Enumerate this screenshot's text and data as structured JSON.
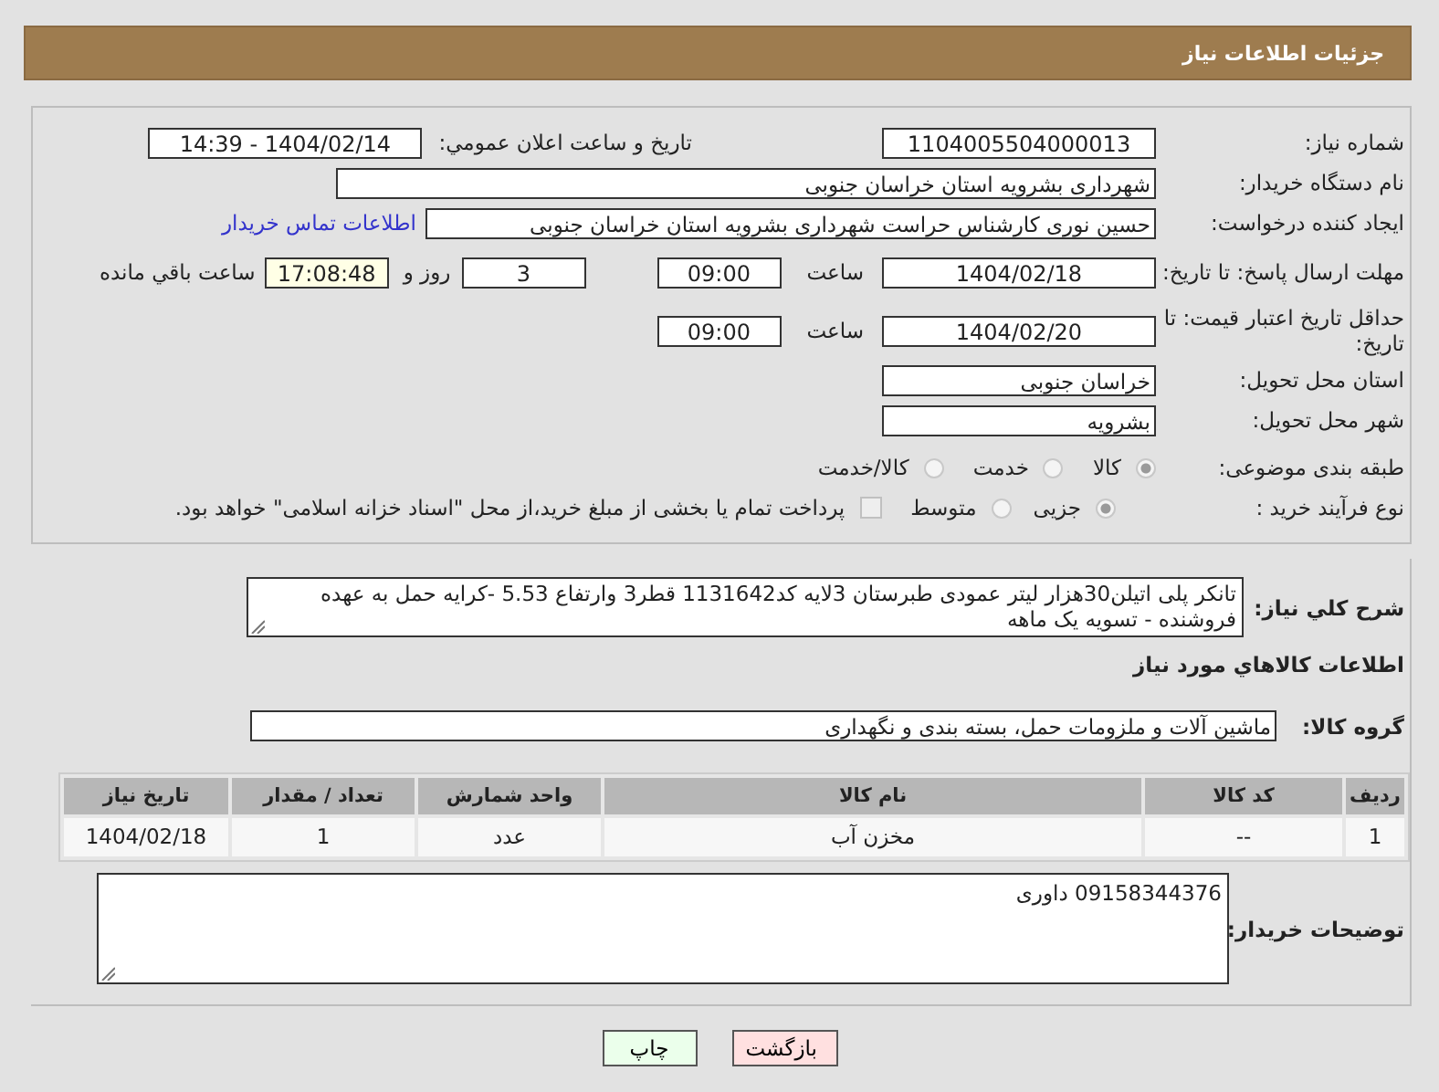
{
  "header": {
    "title": "جزئیات اطلاعات نیاز"
  },
  "need_number": {
    "label": "شماره نیاز:",
    "value": "1104005504000013"
  },
  "announce": {
    "label": "تاریخ و ساعت اعلان عمومي:",
    "value": "1404/02/14 - 14:39"
  },
  "buyer_org": {
    "label": "نام دستگاه خریدار:",
    "value": "شهرداری بشرویه استان خراسان جنوبی"
  },
  "requester": {
    "label": "ایجاد کننده درخواست:",
    "value": "حسین نوری کارشناس حراست شهرداری بشرویه استان خراسان جنوبی",
    "link": "اطلاعات تماس خریدار"
  },
  "response_deadline": {
    "label": "مهلت ارسال پاسخ: تا تاریخ:",
    "date": "1404/02/18",
    "time_label": "ساعت",
    "time": "09:00",
    "days": "3",
    "days_label": "روز و",
    "remaining": "17:08:48",
    "remaining_label": "ساعت باقي مانده"
  },
  "price_validity": {
    "label": "حداقل تاریخ اعتبار قیمت: تا تاریخ:",
    "date": "1404/02/20",
    "time_label": "ساعت",
    "time": "09:00"
  },
  "delivery_province": {
    "label": "استان محل تحویل:",
    "value": "خراسان جنوبی"
  },
  "delivery_city": {
    "label": "شهر محل تحویل:",
    "value": "بشرویه"
  },
  "subject_category": {
    "label": "طبقه بندی موضوعی:",
    "options": [
      {
        "label": "کالا",
        "selected": true
      },
      {
        "label": "خدمت",
        "selected": false
      },
      {
        "label": "کالا/خدمت",
        "selected": false
      }
    ]
  },
  "purchase_type": {
    "label": "نوع فرآیند خرید :",
    "options": [
      {
        "label": "جزیی",
        "selected": true
      },
      {
        "label": "متوسط",
        "selected": false
      }
    ],
    "treasury": {
      "label": "پرداخت تمام یا بخشی از مبلغ خرید،از محل \"اسناد خزانه اسلامی\" خواهد بود.",
      "checked": false
    }
  },
  "description": {
    "label": "شرح کلي نیاز:",
    "value": "تانکر پلی اتیلن30هزار لیتر عمودی طبرستان 3لایه کد1131642 قطر3 وارتفاع 5.53 -کرایه حمل به عهده فروشنده - تسویه یک ماهه"
  },
  "goods_section_title": "اطلاعات کالاهاي مورد نیاز",
  "goods_group": {
    "label": "گروه کالا:",
    "value": "ماشین آلات و ملزومات حمل، بسته بندی و نگهداری"
  },
  "table": {
    "columns": [
      "ردیف",
      "کد کالا",
      "نام کالا",
      "واحد شمارش",
      "تعداد / مقدار",
      "تاریخ نیاز"
    ],
    "rows": [
      [
        "1",
        "--",
        "مخزن آب",
        "عدد",
        "1",
        "1404/02/18"
      ]
    ]
  },
  "buyer_notes": {
    "label": "توضیحات خریدار:",
    "value": "09158344376 داوری"
  },
  "buttons": [
    {
      "label": "بازگشت",
      "kind": "back"
    },
    {
      "label": "چاپ",
      "kind": "print"
    }
  ]
}
